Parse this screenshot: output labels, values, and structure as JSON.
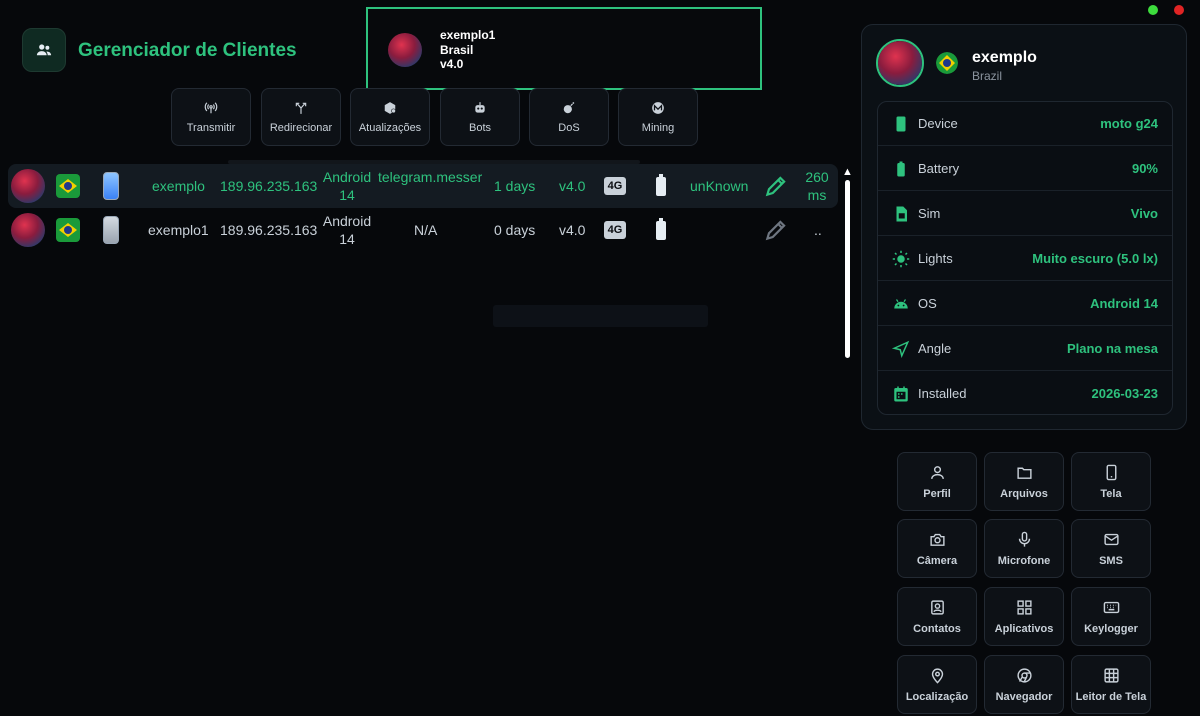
{
  "app": {
    "title": "Gerenciador de Clientes",
    "accent": "#2ec27e",
    "app_icon": "users-icon"
  },
  "window_controls": {
    "maximize_color": "#3ddc3d",
    "close_color": "#e02424"
  },
  "notification": {
    "name": "exemplo1",
    "country": "Brasil",
    "version": "v4.0"
  },
  "toolbar": [
    {
      "label": "Transmitir",
      "icon": "broadcast-icon"
    },
    {
      "label": "Redirecionar",
      "icon": "split-arrows-icon"
    },
    {
      "label": "Atualizações",
      "icon": "package-icon"
    },
    {
      "label": "Bots",
      "icon": "bot-icon"
    },
    {
      "label": "DoS",
      "icon": "bomb-icon"
    },
    {
      "label": "Mining",
      "icon": "monero-icon"
    }
  ],
  "clients": [
    {
      "name": "exemplo",
      "ip": "189.96.235.163",
      "os_line1": "Android",
      "os_line2": "14",
      "app": "telegram.messer",
      "age": "1 days",
      "version": "v4.0",
      "network": "4G",
      "status": "unKnown",
      "ping_line1": "260",
      "ping_line2": "ms",
      "selected": true
    },
    {
      "name": "exemplo1",
      "ip": "189.96.235.163",
      "os_line1": "Android",
      "os_line2": "14",
      "app": "N/A",
      "age": "0 days",
      "version": "v4.0",
      "network": "4G",
      "status": "",
      "ping_line1": "..",
      "ping_line2": "",
      "selected": false
    }
  ],
  "details": {
    "name": "exemplo",
    "country": "Brazil",
    "rows": [
      {
        "label": "Device",
        "value": "moto g24",
        "icon": "device-icon"
      },
      {
        "label": "Battery",
        "value": "90%",
        "icon": "battery-icon"
      },
      {
        "label": "Sim",
        "value": "Vivo",
        "icon": "sim-icon"
      },
      {
        "label": "Lights",
        "value": "Muito escuro (5.0 lx)",
        "icon": "sun-icon"
      },
      {
        "label": "OS",
        "value": "Android 14",
        "icon": "android-icon"
      },
      {
        "label": "Angle",
        "value": "Plano na mesa",
        "icon": "angle-icon"
      },
      {
        "label": "Installed",
        "value": "2026-03-23",
        "icon": "calendar-icon"
      }
    ]
  },
  "actions": [
    {
      "label": "Perfil",
      "icon": "user-icon"
    },
    {
      "label": "Arquivos",
      "icon": "folder-icon"
    },
    {
      "label": "Tela",
      "icon": "phone-screen-icon"
    },
    {
      "label": "Câmera",
      "icon": "camera-icon"
    },
    {
      "label": "Microfone",
      "icon": "microphone-icon"
    },
    {
      "label": "SMS",
      "icon": "mail-icon"
    },
    {
      "label": "Contatos",
      "icon": "contacts-icon"
    },
    {
      "label": "Aplicativos",
      "icon": "apps-grid-icon"
    },
    {
      "label": "Keylogger",
      "icon": "keyboard-icon"
    },
    {
      "label": "Localização",
      "icon": "map-pin-icon"
    },
    {
      "label": "Navegador",
      "icon": "chrome-icon"
    },
    {
      "label": "Leitor de Tela",
      "icon": "screen-reader-icon"
    }
  ]
}
